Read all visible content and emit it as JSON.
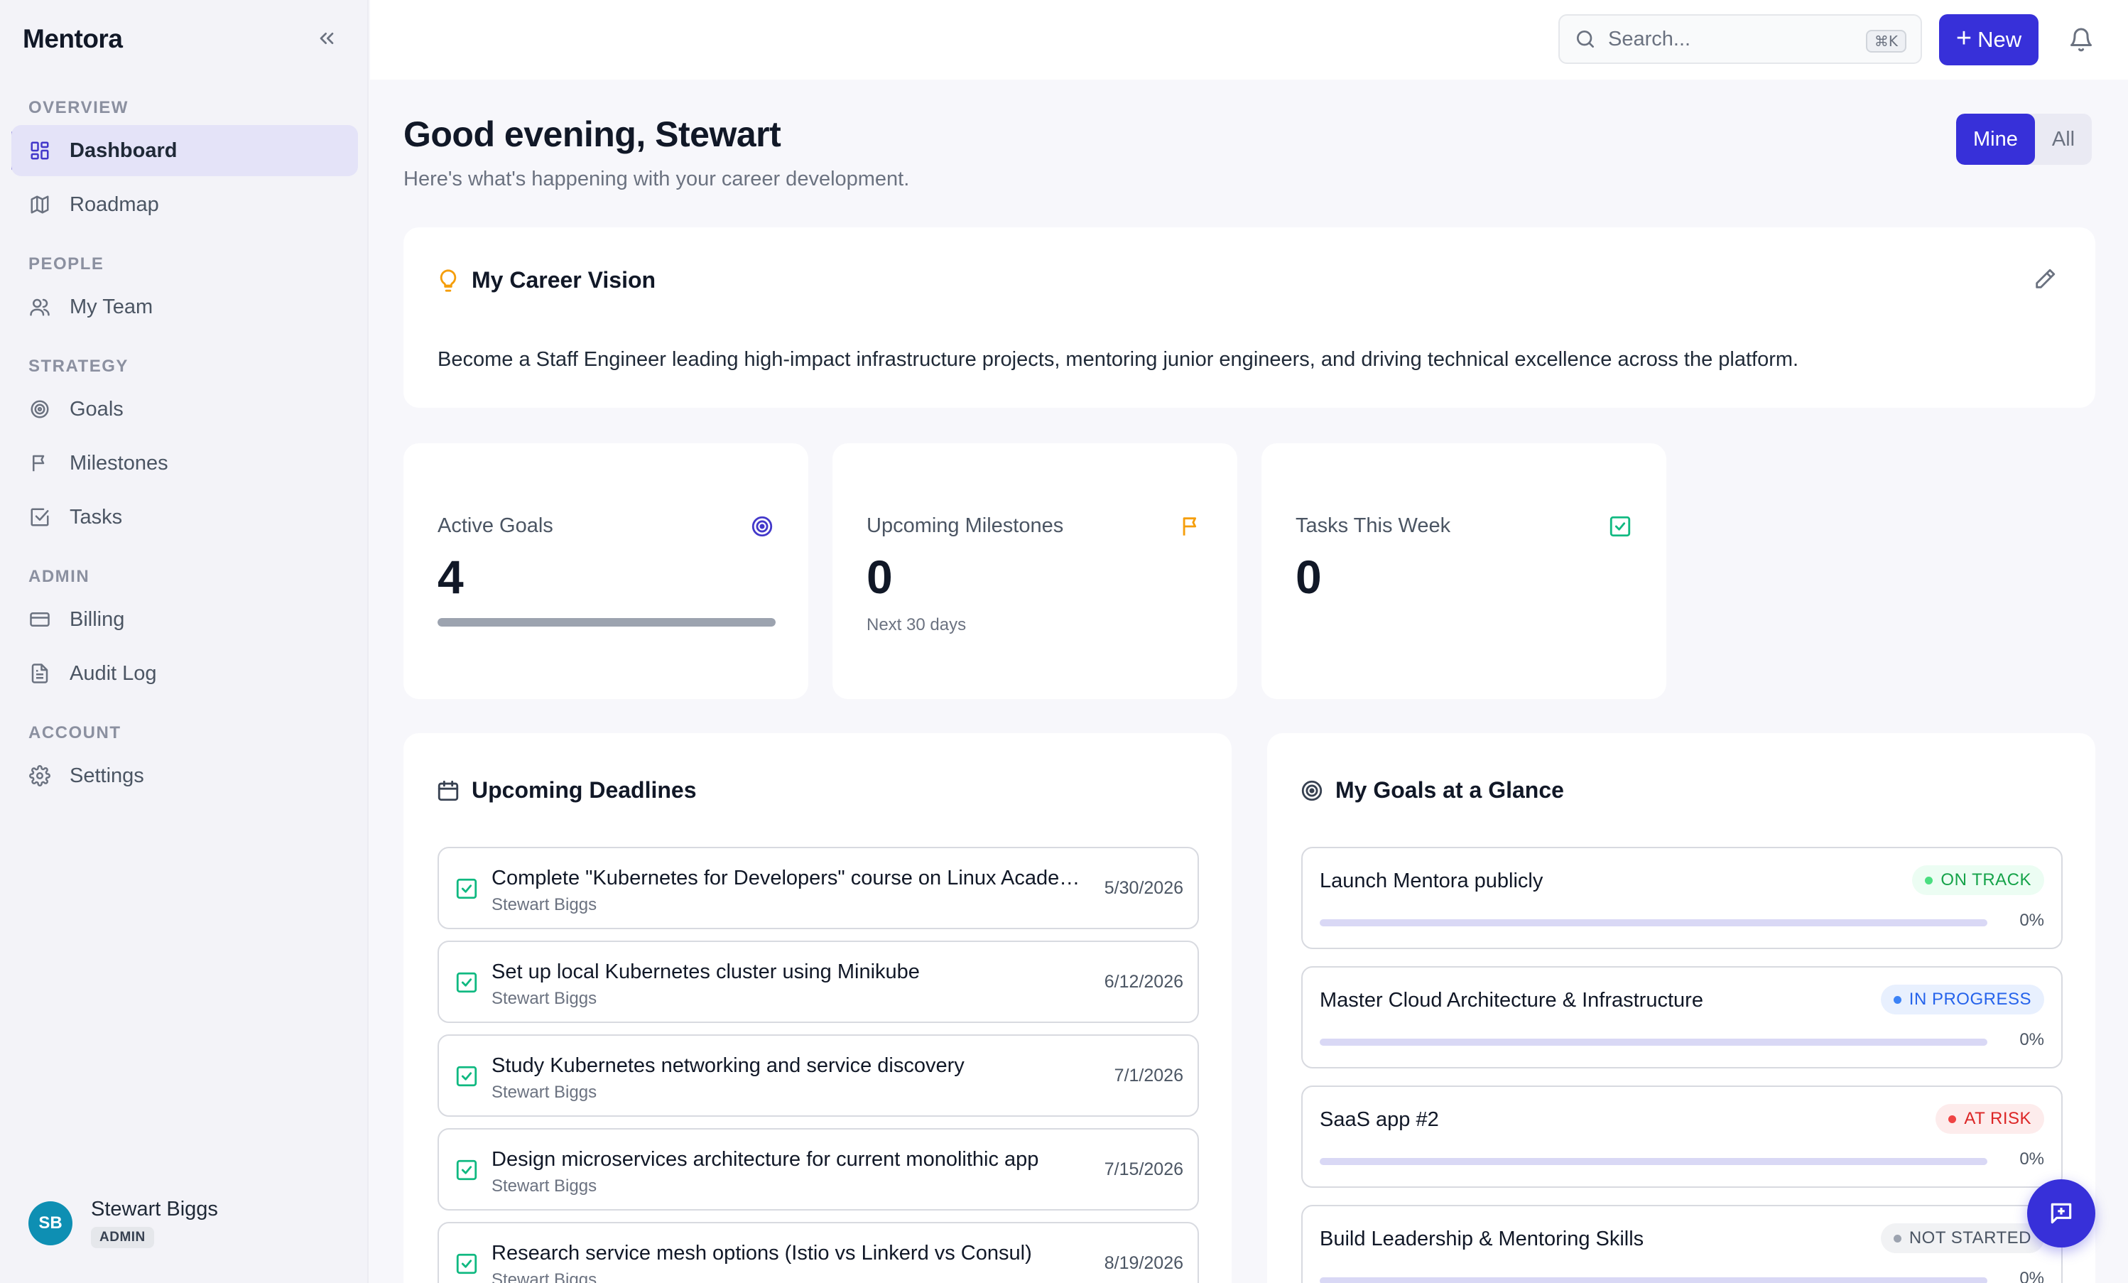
{
  "app": {
    "name": "Mentora"
  },
  "sidebar": {
    "sections": [
      {
        "label": "OVERVIEW"
      },
      {
        "label": "PEOPLE"
      },
      {
        "label": "STRATEGY"
      },
      {
        "label": "ADMIN"
      },
      {
        "label": "ACCOUNT"
      }
    ],
    "items": [
      {
        "label": "Dashboard",
        "icon": "dashboard-icon",
        "active": true
      },
      {
        "label": "Roadmap",
        "icon": "map-icon"
      },
      {
        "label": "My Team",
        "icon": "users-icon"
      },
      {
        "label": "Goals",
        "icon": "target-icon"
      },
      {
        "label": "Milestones",
        "icon": "flag-icon"
      },
      {
        "label": "Tasks",
        "icon": "check-square-icon"
      },
      {
        "label": "Billing",
        "icon": "credit-card-icon"
      },
      {
        "label": "Audit Log",
        "icon": "document-icon"
      },
      {
        "label": "Settings",
        "icon": "gear-icon"
      }
    ],
    "user": {
      "initials": "SB",
      "name": "Stewart Biggs",
      "role": "ADMIN"
    }
  },
  "topbar": {
    "search_placeholder": "Search...",
    "shortcut": "⌘K",
    "new_label": "New"
  },
  "main": {
    "greeting": "Good evening, Stewart",
    "subtitle": "Here's what's happening with your career development.",
    "scope": {
      "mine": "Mine",
      "all": "All",
      "selected": "Mine"
    },
    "vision": {
      "title": "My Career Vision",
      "text": "Become a Staff Engineer leading high-impact infrastructure projects, mentoring junior engineers, and driving technical excellence across the platform."
    },
    "stats": [
      {
        "label": "Active Goals",
        "value": "4",
        "icon": "target-icon",
        "color": "#4338ca",
        "progress": 1.0
      },
      {
        "label": "Upcoming Milestones",
        "value": "0",
        "note": "Next 30 days",
        "icon": "flag-icon",
        "color": "#f59e0b"
      },
      {
        "label": "Tasks This Week",
        "value": "0",
        "icon": "check-square-icon",
        "color": "#10b981"
      }
    ],
    "deadlines": {
      "title": "Upcoming Deadlines",
      "items": [
        {
          "title": "Complete \"Kubernetes for Developers\" course on Linux Academy",
          "owner": "Stewart Biggs",
          "date": "5/30/2026"
        },
        {
          "title": "Set up local Kubernetes cluster using Minikube",
          "owner": "Stewart Biggs",
          "date": "6/12/2026"
        },
        {
          "title": "Study Kubernetes networking and service discovery",
          "owner": "Stewart Biggs",
          "date": "7/1/2026"
        },
        {
          "title": "Design microservices architecture for current monolithic app",
          "owner": "Stewart Biggs",
          "date": "7/15/2026"
        },
        {
          "title": "Research service mesh options (Istio vs Linkerd vs Consul)",
          "owner": "Stewart Biggs",
          "date": "8/19/2026"
        }
      ]
    },
    "goals": {
      "title": "My Goals at a Glance",
      "items": [
        {
          "title": "Launch Mentora publicly",
          "status": "ON TRACK",
          "status_color": "#16a34a",
          "status_bg": "#ecfdf3",
          "dot": "#4ade80",
          "progress": "0%"
        },
        {
          "title": "Master Cloud Architecture & Infrastructure",
          "status": "IN PROGRESS",
          "status_color": "#2563eb",
          "status_bg": "#e8f0fe",
          "dot": "#3b82f6",
          "progress": "0%"
        },
        {
          "title": "SaaS app #2",
          "status": "AT RISK",
          "status_color": "#dc2626",
          "status_bg": "#fdecec",
          "dot": "#ef4444",
          "progress": "0%"
        },
        {
          "title": "Build Leadership & Mentoring Skills",
          "status": "NOT STARTED",
          "status_color": "#4b5563",
          "status_bg": "#f1f2f4",
          "dot": "#9ca3af",
          "progress": "0%"
        }
      ]
    }
  }
}
